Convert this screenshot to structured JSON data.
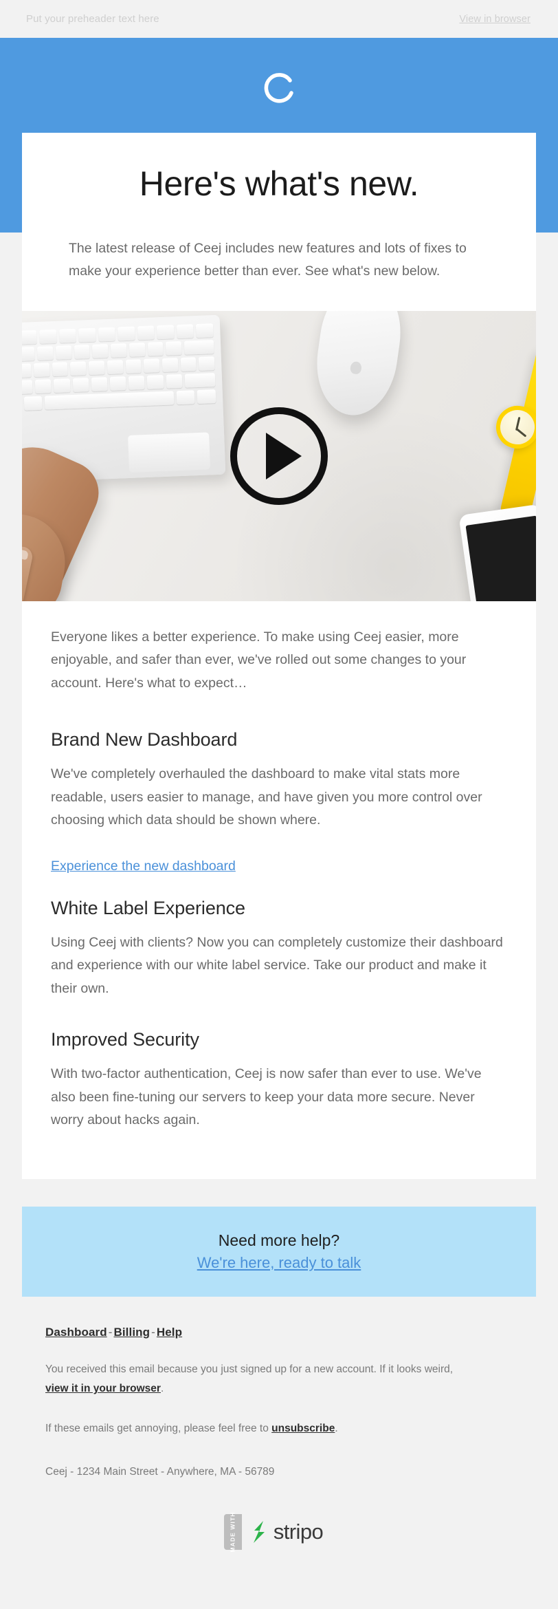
{
  "preheader": {
    "text": "Put your preheader text here",
    "view_in_browser": "View in browser"
  },
  "header": {
    "logo_icon": "ceej-c-logo-icon",
    "brand_color": "#4f9ae0"
  },
  "hero": {
    "headline": "Here's what's new.",
    "intro": "The latest release of Ceej includes new features and lots of fixes to make your experience better than ever. See what's new below.",
    "image_alt": "hand typing on keyboard with mouse, yellow watch and phone on desk",
    "play_button": "play-button"
  },
  "body": {
    "lead": "Everyone likes a better experience. To make using Ceej easier, more enjoyable, and safer than ever, we've rolled out some changes to your account. Here's what to expect…",
    "sections": [
      {
        "title": "Brand New Dashboard",
        "text": "We've completely overhauled the dashboard to make vital stats more readable, users easier to manage, and have given you more control over choosing which data should be shown where.",
        "link": "Experience the new dashboard"
      },
      {
        "title": "White Label Experience",
        "text": "Using Ceej with clients? Now you can completely customize their dashboard and experience with our white label service. Take our product and make it their own.",
        "link": ""
      },
      {
        "title": "Improved Security",
        "text": "With two-factor authentication, Ceej is now safer than ever to use. We've also been fine-tuning our servers to keep your data more secure. Never worry about hacks again.",
        "link": ""
      }
    ]
  },
  "help": {
    "title": "Need more help?",
    "link": "We're here, ready to talk",
    "background": "#b3e1f9"
  },
  "footer": {
    "nav": [
      {
        "label": "Dashboard"
      },
      {
        "label": "Billing"
      },
      {
        "label": "Help"
      }
    ],
    "separator": "-",
    "legal_before": "You received this email because you just signed up for a new account. If it looks weird,",
    "legal_link": "view it in your browser",
    "legal_after": ".",
    "unsub_before": "If these emails get annoying, please feel free to",
    "unsub_link": "unsubscribe",
    "unsub_after": ".",
    "address": "Ceej - 1234 Main Street - Anywhere, MA - 56789"
  },
  "badge": {
    "ribbon": "MADE WITH",
    "wordmark": "stripo",
    "logo_icon": "stripo-s-icon",
    "logo_color": "#2cb34a"
  }
}
